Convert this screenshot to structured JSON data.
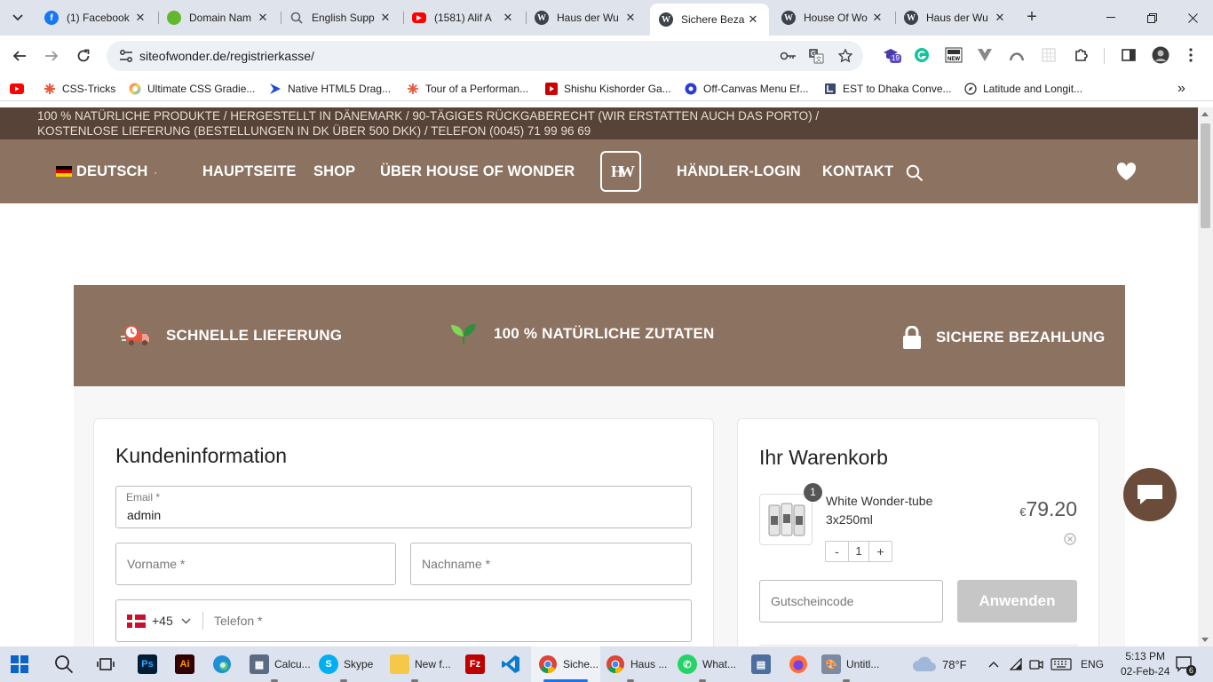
{
  "browser": {
    "tabs": [
      {
        "title": "(1) Facebook",
        "icon": "facebook-icon",
        "color": "#1877f2"
      },
      {
        "title": "Domain Nam",
        "icon": "green-dot-icon",
        "color": "#62b82d"
      },
      {
        "title": "English Supp",
        "icon": "support-icon",
        "color": "#5f6368"
      },
      {
        "title": "(1581) Alif A",
        "icon": "youtube-icon",
        "color": "#ff0000"
      },
      {
        "title": "Haus der Wu",
        "icon": "wordpress-icon",
        "color": "#3c434a"
      },
      {
        "title": "Sichere Beza",
        "icon": "wordpress-icon",
        "color": "#3c434a"
      },
      {
        "title": "House Of Wo",
        "icon": "wordpress-icon",
        "color": "#3c434a"
      },
      {
        "title": "Haus der Wu",
        "icon": "wordpress-icon",
        "color": "#3c434a"
      }
    ],
    "active_tab": 5,
    "url": "siteofwonder.de/registrierkasse/",
    "extension_badge": "19",
    "bookmarks": [
      {
        "label": "",
        "icon": "youtube-icon"
      },
      {
        "label": "CSS-Tricks",
        "icon": "css-tricks-icon"
      },
      {
        "label": "Ultimate CSS Gradie...",
        "icon": "gradient-icon"
      },
      {
        "label": "Native HTML5 Drag...",
        "icon": "html5-drag-icon"
      },
      {
        "label": "Tour of a Performan...",
        "icon": "asterisk-icon"
      },
      {
        "label": "Shishu Kishorder Ga...",
        "icon": "youtube-icon"
      },
      {
        "label": "Off-Canvas Menu Ef...",
        "icon": "offcanvas-icon"
      },
      {
        "label": "EST to Dhaka Conve...",
        "icon": "clock-converter-icon"
      },
      {
        "label": "Latitude and Longit...",
        "icon": "compass-icon"
      }
    ]
  },
  "site": {
    "topbar_line1": "100 % NATÜRLICHE PRODUKTE  /  HERGESTELLT IN DÄNEMARK  /  90-TÄGIGES RÜCKGABERECHT (WIR ERSTATTEN AUCH DAS PORTO)  /",
    "topbar_line2": "KOSTENLOSE LIEFERUNG (BESTELLUNGEN IN DK ÜBER 500 DKK)  /  TELEFON (0045) 71 99 96 69",
    "nav": {
      "language": "DEUTSCH",
      "language_suffix": "·",
      "home": "HAUPTSEITE",
      "shop": "SHOP",
      "about": "ÜBER HOUSE OF WONDER",
      "logo": "HW",
      "dealer_login": "HÄNDLER-LOGIN",
      "contact": "KONTAKT"
    },
    "features": [
      {
        "label": "SCHNELLE LIEFERUNG",
        "icon": "delivery-truck-icon"
      },
      {
        "label": "100 % NATÜRLICHE ZUTATEN",
        "icon": "leaf-icon"
      },
      {
        "label": "SICHERE BEZAHLUNG",
        "icon": "lock-icon"
      }
    ],
    "customer_info": {
      "heading": "Kundeninformation",
      "email_label": "Email *",
      "email_value": "admin",
      "first_name_placeholder": "Vorname *",
      "last_name_placeholder": "Nachname *",
      "phone_code": "+45",
      "phone_placeholder": "Telefon *"
    },
    "cart": {
      "heading": "Ihr Warenkorb",
      "item_badge": "1",
      "item_name_line1": "White Wonder-tube",
      "item_name_line2": "3x250ml",
      "currency": "€",
      "price": "79.20",
      "qty_minus": "-",
      "qty": "1",
      "qty_plus": "+",
      "coupon_placeholder": "Gutscheincode",
      "apply_label": "Anwenden"
    }
  },
  "taskbar": {
    "items": [
      {
        "label": "",
        "icon": "search-icon"
      },
      {
        "label": "",
        "icon": "task-view-icon"
      },
      {
        "label": "",
        "icon": "photoshop-icon"
      },
      {
        "label": "",
        "icon": "illustrator-icon"
      },
      {
        "label": "",
        "icon": "edge-icon"
      },
      {
        "label": "Calcu...",
        "icon": "calculator-icon"
      },
      {
        "label": "Skype",
        "icon": "skype-icon"
      },
      {
        "label": "New f...",
        "icon": "folder-icon"
      },
      {
        "label": "",
        "icon": "filezilla-icon"
      },
      {
        "label": "",
        "icon": "vscode-icon"
      },
      {
        "label": "Siche...",
        "icon": "chrome-icon"
      },
      {
        "label": "Haus ...",
        "icon": "chrome-icon"
      },
      {
        "label": "What...",
        "icon": "whatsapp-icon"
      },
      {
        "label": "",
        "icon": "network-monitor-icon"
      },
      {
        "label": "",
        "icon": "firefox-icon"
      },
      {
        "label": "Untitl...",
        "icon": "paint-icon"
      }
    ],
    "weather": "78°F",
    "language": "ENG",
    "time": "5:13 PM",
    "date": "02-Feb-24",
    "notification_count": "6"
  }
}
